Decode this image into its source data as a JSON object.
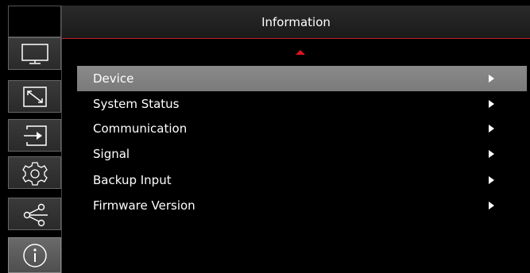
{
  "header": {
    "title": "Information"
  },
  "sidebar": {
    "items": [
      {
        "name": "display",
        "icon": "monitor-icon",
        "active": false
      },
      {
        "name": "resize",
        "icon": "resize-icon",
        "active": false
      },
      {
        "name": "input",
        "icon": "input-icon",
        "active": false
      },
      {
        "name": "setup",
        "icon": "gear-icon",
        "active": false
      },
      {
        "name": "network",
        "icon": "share-icon",
        "active": false
      },
      {
        "name": "information",
        "icon": "info-icon",
        "active": true
      }
    ]
  },
  "menu": {
    "items": [
      {
        "label": "Device",
        "selected": true
      },
      {
        "label": "System Status",
        "selected": false
      },
      {
        "label": "Communication",
        "selected": false
      },
      {
        "label": "Signal",
        "selected": false
      },
      {
        "label": "Backup Input",
        "selected": false
      },
      {
        "label": "Firmware Version",
        "selected": false
      }
    ]
  },
  "colors": {
    "accent": "#e0141e",
    "selection": "#808080",
    "background": "#000000"
  }
}
